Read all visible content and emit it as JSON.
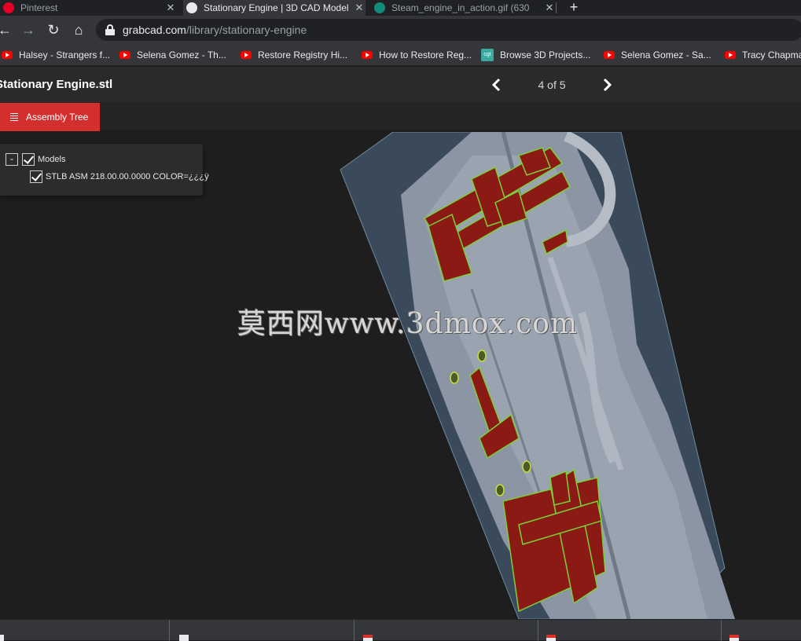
{
  "browser": {
    "tabs": [
      {
        "title": "Pinterest",
        "icon": "pinterest-icon",
        "active": false
      },
      {
        "title": "Stationary Engine | 3D CAD Model",
        "icon": "grabcad-icon",
        "active": true
      },
      {
        "title": "Steam_engine_in_action.gif (630",
        "icon": "wikimedia-icon",
        "active": false
      }
    ],
    "url_host": "grabcad.com",
    "url_path": "/library/stationary-engine",
    "bookmarks": [
      {
        "label": "Halsey - Strangers f...",
        "icon": "youtube-icon"
      },
      {
        "label": "Selena Gomez - Th...",
        "icon": "youtube-icon"
      },
      {
        "label": "Restore Registry Hi...",
        "icon": "youtube-icon"
      },
      {
        "label": "How to Restore Reg...",
        "icon": "youtube-icon"
      },
      {
        "label": "Browse 3D Projects...",
        "icon": "cgtrader-icon",
        "icon_text": "cgt"
      },
      {
        "label": "Selena Gomez - Sa...",
        "icon": "youtube-icon"
      },
      {
        "label": "Tracy Chapma",
        "icon": "youtube-icon"
      }
    ]
  },
  "viewer": {
    "file_title": "Stationary Engine.stl",
    "pager": {
      "current": 4,
      "total": 5,
      "label": "4 of 5"
    },
    "assembly_tree_label": "Assembly Tree",
    "tree": {
      "root_label": "Models",
      "root_checked": true,
      "children": [
        {
          "label": "STLB ASM 218.00.00.0000 COLOR=¿¿¿ÿ",
          "checked": true
        }
      ]
    },
    "watermark": "莫西网www.3dmox.com"
  },
  "colors": {
    "accent_red": "#d32f2f",
    "model_body": "#8c95a3",
    "model_section": "#8b1a14",
    "section_edge": "#7ccf3a",
    "plate": "#3b4a5a"
  }
}
